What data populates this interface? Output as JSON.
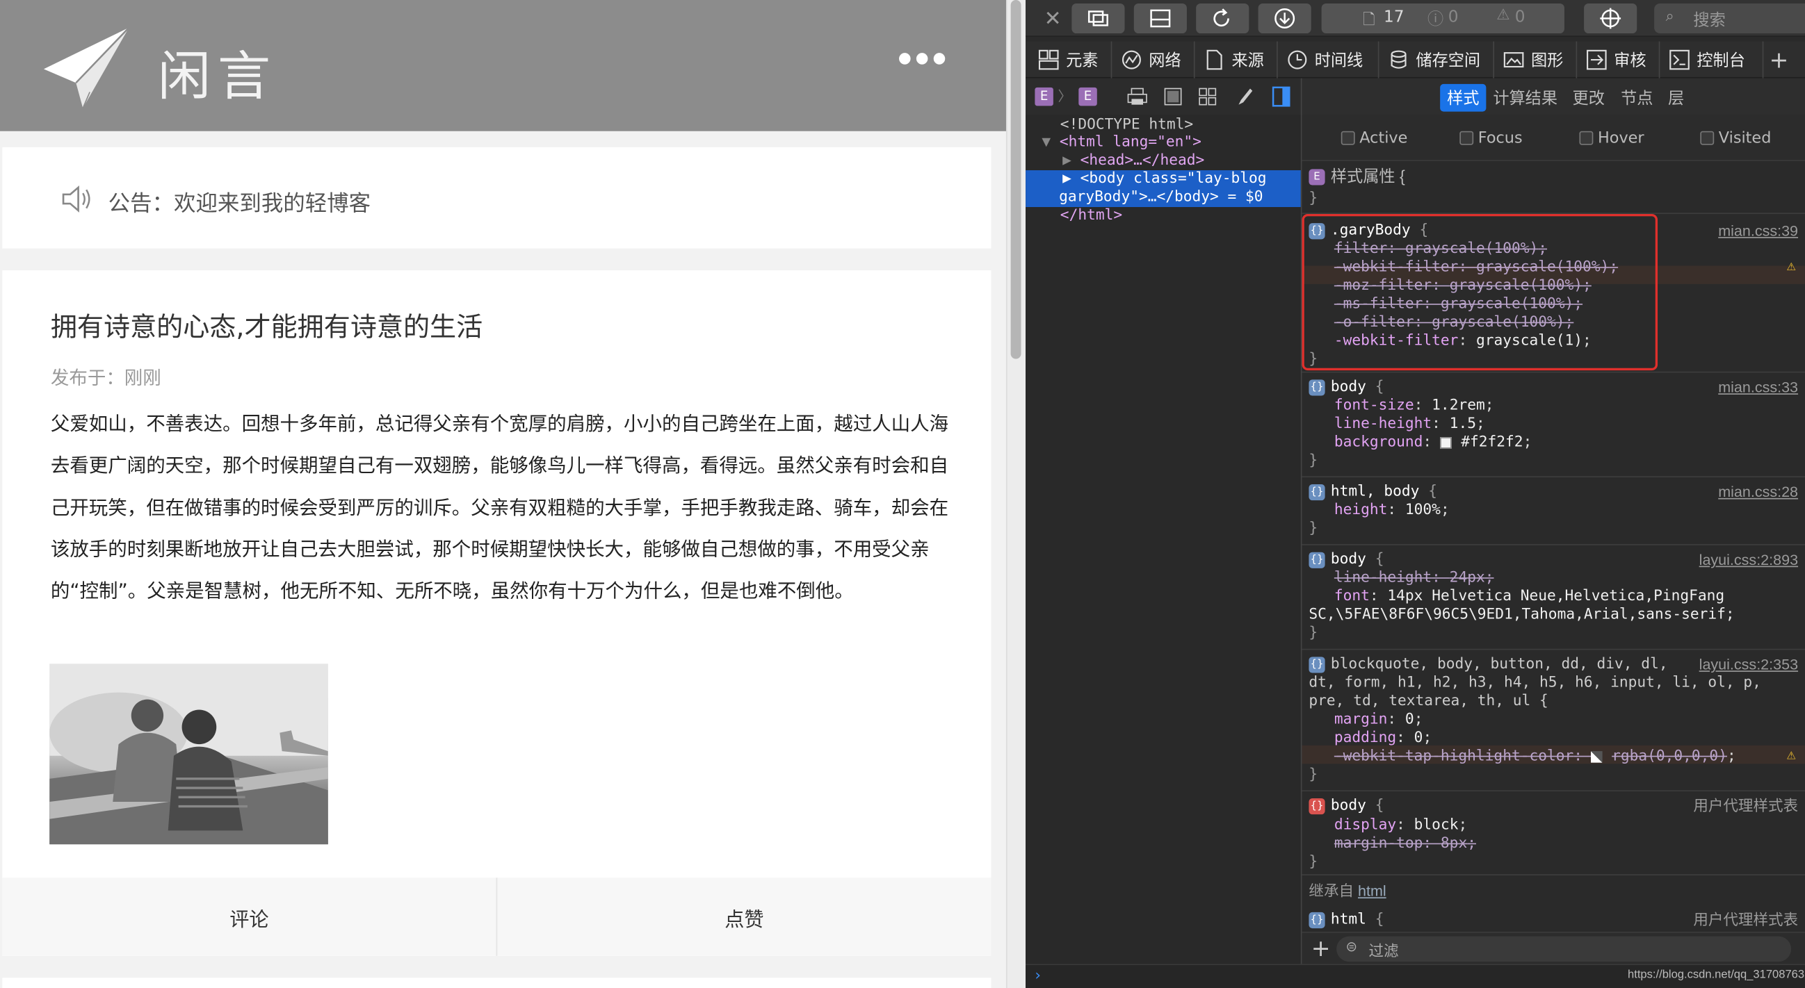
{
  "page": {
    "logo_text": "闲言",
    "notice": "公告：欢迎来到我的轻博客",
    "article": {
      "title": "拥有诗意的心态,才能拥有诗意的生活",
      "meta": "发布于：刚刚",
      "body": "父爱如山，不善表达。回想十多年前，总记得父亲有个宽厚的肩膀，小小的自己跨坐在上面，越过人山人海去看更广阔的天空，那个时候期望自己有一双翅膀，能够像鸟儿一样飞得高，看得远。虽然父亲有时会和自己开玩笑，但在做错事的时候会受到严厉的训斥。父亲有双粗糙的大手掌，手把手教我走路、骑车，却会在该放手的时刻果断地放开让自己去大胆尝试，那个时候期望快快长大，能够做自己想做的事，不用受父亲的“控制”。父亲是智慧树，他无所不知、无所不晓，虽然你有十万个为什么，但是也难不倒他。"
    },
    "actions": {
      "comment": "评论",
      "like": "点赞"
    }
  },
  "devtools": {
    "toolbar": {
      "resource_count": "17",
      "error_count": "0",
      "warning_count": "0",
      "search_placeholder": "搜索"
    },
    "tabs": [
      "元素",
      "网络",
      "来源",
      "时间线",
      "储存空间",
      "图形",
      "审核",
      "控制台"
    ],
    "sidebar_tabs": [
      "样式",
      "计算结果",
      "更改",
      "节点",
      "层"
    ],
    "states": [
      "Active",
      "Focus",
      "Hover",
      "Visited"
    ],
    "dom": [
      "<!DOCTYPE html>",
      "<html lang=\"en\">",
      "<head>…</head>",
      "<body class=\"lay-blog",
      "garyBody\">…</body> = $0",
      "</html>"
    ],
    "style_attr_label": "样式属性",
    "rules": [
      {
        "selector": ".garyBody",
        "source": "mian.css:39",
        "props": [
          [
            "filter",
            "grayscale(100%)"
          ],
          [
            "-webkit-filter",
            "grayscale(100%)"
          ],
          [
            "-moz-filter",
            "grayscale(100%)"
          ],
          [
            "-ms-filter",
            "grayscale(100%)"
          ],
          [
            "-o-filter",
            "grayscale(100%)"
          ],
          [
            "-webkit-filter",
            "grayscale(1)"
          ]
        ]
      },
      {
        "selector": "body",
        "source": "mian.css:33",
        "props": [
          [
            "font-size",
            "1.2rem"
          ],
          [
            "line-height",
            "1.5"
          ],
          [
            "background",
            "#f2f2f2"
          ]
        ]
      },
      {
        "selector": "html, body",
        "source": "mian.css:28",
        "props": [
          [
            "height",
            "100%"
          ]
        ]
      },
      {
        "selector": "body",
        "source": "layui.css:2:893",
        "props": [
          [
            "line-height",
            "24px"
          ],
          [
            "font",
            "14px Helvetica Neue,Helvetica,PingFang"
          ]
        ],
        "extra": "SC,\\5FAE\\8F6F\\96C5\\9ED1,Tahoma,Arial,sans-serif;"
      },
      {
        "selector": "blockquote, body, button, dd, div, dl,",
        "selector2": "dt, form, h1, h2, h3, h4, h5, h6, input, li, ol, p,",
        "selector3": "pre, td, textarea, th, ul {",
        "source": "layui.css:2:353",
        "props": [
          [
            "margin",
            "0"
          ],
          [
            "padding",
            "0"
          ],
          [
            "-webkit-tap-highlight-color",
            "rgba(0,0,0,0)"
          ]
        ]
      },
      {
        "selector": "body",
        "source": "用户代理样式表",
        "props": [
          [
            "display",
            "block"
          ],
          [
            "margin-top",
            "8px"
          ]
        ]
      }
    ],
    "inherited_label": "继承自",
    "inherited_link": "html",
    "last_selector": "html",
    "last_source": "用户代理样式表",
    "filter_placeholder": "过滤",
    "watermark": "https://blog.csdn.net/qq_31708763"
  },
  "colors": {
    "accent": "#1a73e8",
    "highlight_red": "#e0302c",
    "header_gray": "#8c8c8c"
  }
}
